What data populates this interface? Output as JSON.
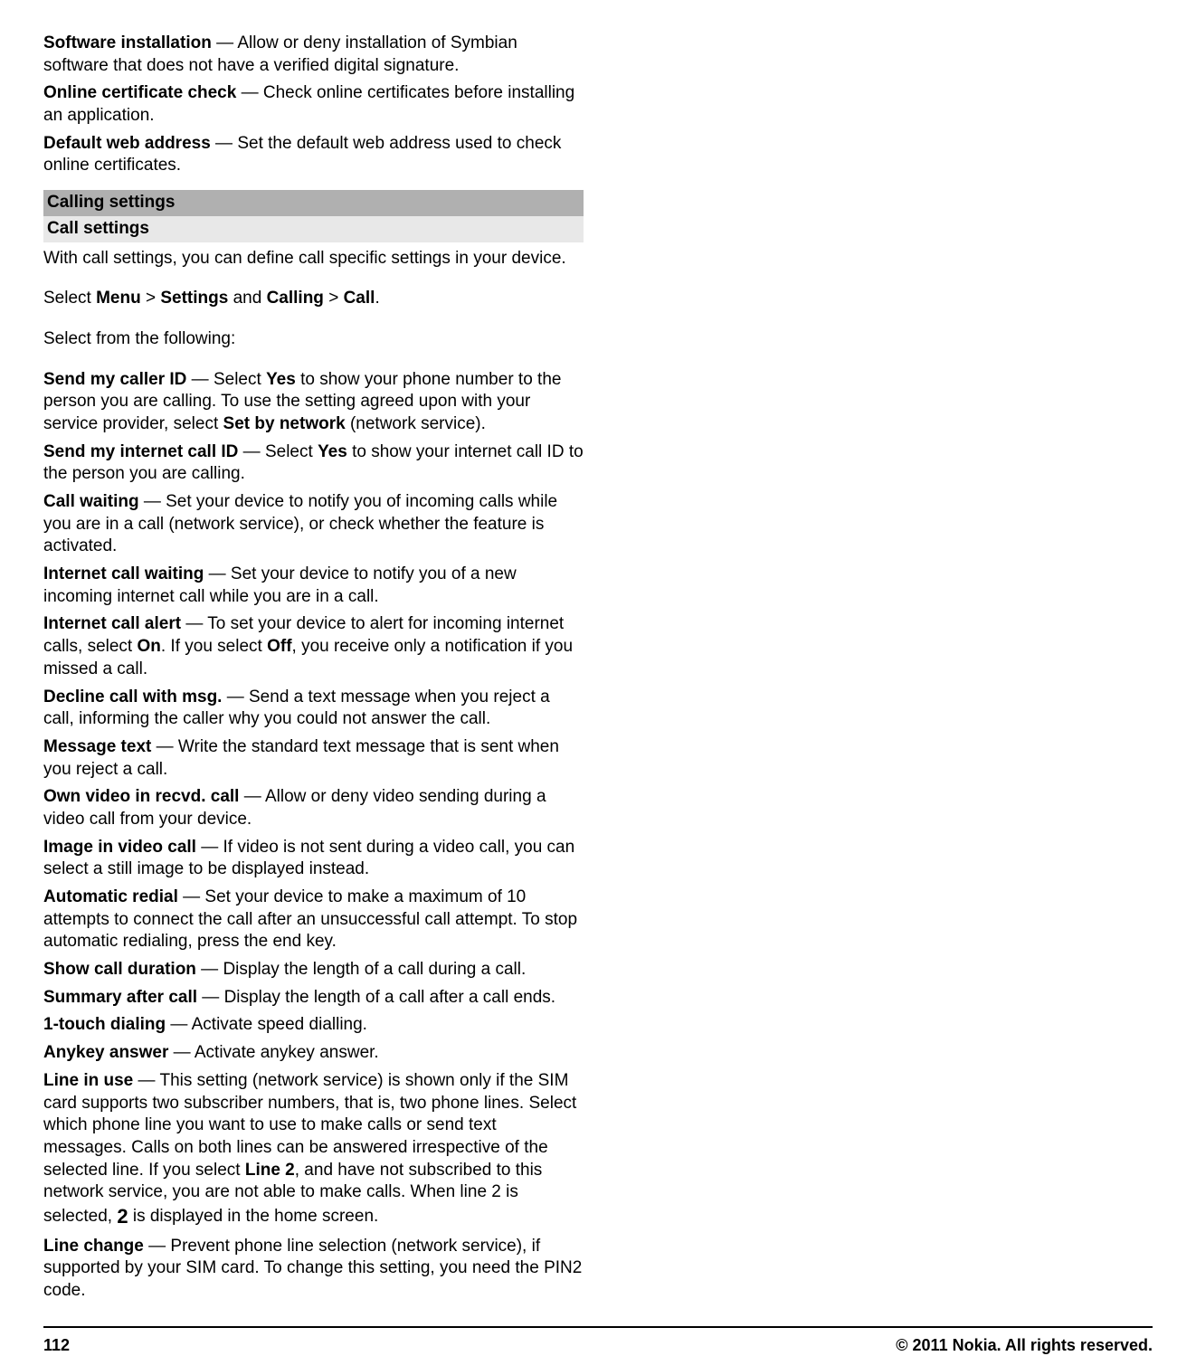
{
  "col1": {
    "software_installation": {
      "title": "Software installation",
      "body": " — Allow or deny installation of Symbian software that does not have a verified digital signature."
    },
    "online_cert": {
      "title": "Online certificate check",
      "body": " — Check online certificates before installing an application."
    },
    "default_web": {
      "title": "Default web address",
      "body": " — Set the default web address used to check online certificates."
    },
    "calling_settings": "Calling settings",
    "call_settings": "Call settings",
    "call_settings_intro": "With call settings, you can define call specific settings in your device.",
    "select_path": {
      "pre": "Select ",
      "menu": "Menu",
      "sep1": " > ",
      "settings": "Settings",
      "and": " and ",
      "calling": "Calling",
      "sep2": " > ",
      "call": "Call",
      "end": "."
    },
    "select_from": "Select from the following:",
    "send_caller_id": {
      "title": "Send my caller ID",
      "pre": " — Select ",
      "yes": "Yes",
      "mid": " to show your phone number to the person you are calling. To use the setting agreed upon with your service provider, select ",
      "setby": "Set by network",
      "post": " (network service)."
    },
    "send_internet_id": {
      "title": "Send my internet call ID",
      "pre": " — Select ",
      "yes": "Yes",
      "post": " to show your internet call ID to the person you are calling."
    },
    "call_waiting": {
      "title": "Call waiting",
      "body": " — Set your device to notify you of incoming calls while you are in a call (network service), or check whether the feature is activated."
    },
    "internet_call_waiting": {
      "title": "Internet call waiting",
      "body": " — Set your device to notify you of a new incoming internet call while you are in a call."
    },
    "internet_call_alert": {
      "title": "Internet call alert",
      "pre": " — To set your device to alert for incoming internet calls, select ",
      "on": "On",
      "mid": ". If you select ",
      "off": "Off",
      "post": ", you receive only a notification if you missed a call."
    }
  },
  "col2": {
    "decline_msg": {
      "title": "Decline call with msg.",
      "body": " — Send a text message when you reject a call, informing the caller why you could not answer the call."
    },
    "message_text": {
      "title": "Message text",
      "body": " — Write the standard text message that is sent when you reject a call."
    },
    "own_video": {
      "title": "Own video in recvd. call",
      "body": " — Allow or deny video sending during a video call from your device."
    },
    "image_video": {
      "title": "Image in video call",
      "body": " — If video is not sent during a video call, you can select a still image to be displayed instead."
    },
    "auto_redial": {
      "title": "Automatic redial",
      "body": " — Set your device to make a maximum of 10 attempts to connect the call after an unsuccessful call attempt. To stop automatic redialing, press the end key."
    },
    "show_duration": {
      "title": "Show call duration",
      "body": " — Display the length of a call during a call."
    },
    "summary_after": {
      "title": "Summary after call",
      "body": " — Display the length of a call after a call ends."
    },
    "one_touch": {
      "title": "1-touch dialing",
      "body": " — Activate speed dialling."
    },
    "anykey": {
      "title": "Anykey answer",
      "body": " — Activate anykey answer."
    },
    "line_in_use": {
      "title": "Line in use",
      "pre": " — This setting (network service) is shown only if the SIM card supports two subscriber numbers, that is, two phone lines. Select which phone line you want to use to make calls or send text messages. Calls on both lines can be answered irrespective of the selected line. If you select ",
      "line2": "Line 2",
      "mid": ", and have not subscribed to this network service, you are not able to make calls. When line 2 is selected, ",
      "icon": "2",
      "post": " is displayed in the home screen."
    },
    "line_change": {
      "title": "Line change",
      "body": " — Prevent phone line selection (network service), if supported by your SIM card. To change this setting, you need the PIN2 code."
    }
  },
  "footer": {
    "page": "112",
    "copyright": "© 2011 Nokia. All rights reserved."
  }
}
